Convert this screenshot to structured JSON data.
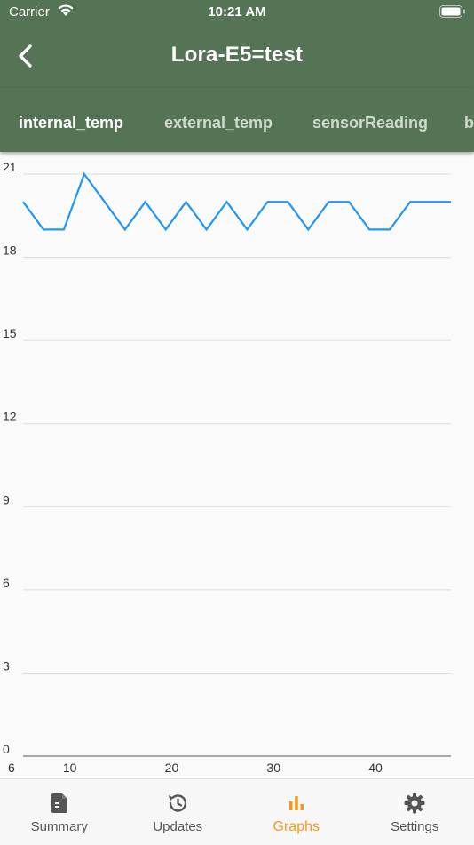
{
  "status": {
    "carrier": "Carrier",
    "time": "10:21 AM"
  },
  "header": {
    "title": "Lora-E5=test"
  },
  "tabs": [
    {
      "label": "internal_temp",
      "active": true
    },
    {
      "label": "external_temp",
      "active": false
    },
    {
      "label": "sensorReading",
      "active": false
    },
    {
      "label": "b",
      "active": false
    }
  ],
  "chart_data": {
    "type": "line",
    "xlabel": "",
    "ylabel": "",
    "xlim": [
      6,
      48
    ],
    "ylim": [
      0,
      21
    ],
    "x_ticks": [
      10,
      20,
      30,
      40
    ],
    "x_start_label": "6",
    "y_ticks": [
      0,
      3,
      6,
      9,
      12,
      15,
      18,
      21
    ],
    "grid": true,
    "series": [
      {
        "color": "#2196f3",
        "x": [
          6,
          8,
          10,
          12,
          14,
          16,
          18,
          20,
          22,
          24,
          26,
          28,
          30,
          32,
          34,
          36,
          38,
          40,
          42,
          44,
          46,
          48
        ],
        "values": [
          20,
          19,
          19,
          21,
          20,
          19,
          20,
          19,
          20,
          19,
          20,
          19,
          20,
          20,
          19,
          20,
          20,
          19,
          19,
          20,
          20,
          20
        ]
      }
    ]
  },
  "bottom_nav": {
    "items": [
      {
        "label": "Summary",
        "icon": "document-icon",
        "active": false
      },
      {
        "label": "Updates",
        "icon": "history-icon",
        "active": false
      },
      {
        "label": "Graphs",
        "icon": "bar-chart-icon",
        "active": true
      },
      {
        "label": "Settings",
        "icon": "gear-icon",
        "active": false
      }
    ]
  },
  "colors": {
    "app_bar": "#557355",
    "accent": "#f09a1a",
    "line": "#2196f3",
    "grid": "#dddddd"
  }
}
